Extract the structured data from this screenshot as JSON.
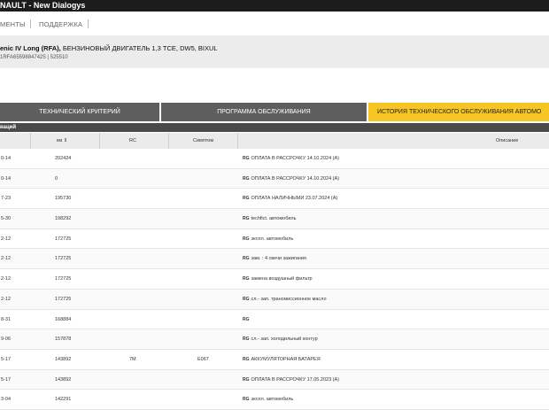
{
  "app": {
    "title": "NAULT -  New Dialogys"
  },
  "menu": {
    "items": [
      "МЕНТЫ",
      "ПОДДЕРЖКА"
    ]
  },
  "vehicle": {
    "name": "enic IV Long (RFA),",
    "engine": " БЕНЗИНОВЫЙ ДВИГАТЕЛЬ 1,3 TCE, DW5, BIXUL",
    "vin": "1RFA65598847425 | 525510"
  },
  "tabs": [
    {
      "label": "ТЕХНИЧЕСКИЙ КРИТЕРИЙ"
    },
    {
      "label": "ПРОГРАММА ОБСЛУЖИВАНИЯ"
    },
    {
      "label": "ИСТОРИЯ ТЕХНИЧЕСКОГО ОБСЛУЖИВАНИЯ АВТОМО"
    }
  ],
  "section": {
    "title": "ваций"
  },
  "table": {
    "headers": {
      "date": "",
      "km": "км ⇕",
      "rc": "RC",
      "symptom": "Симптом",
      "desc": "Описание"
    },
    "rows": [
      {
        "date": "0-14",
        "km": "202424",
        "rc": "",
        "sym": "",
        "badge": "RG",
        "desc": "ОПЛАТА В РАССРОЧКУ 14.10.2024 (A)"
      },
      {
        "date": "0-14",
        "km": "0",
        "rc": "",
        "sym": "",
        "badge": "RG",
        "desc": "ОПЛАТА В РАССРОЧКУ 14.10.2024 (A)"
      },
      {
        "date": "7-23",
        "km": "195730",
        "rc": "",
        "sym": "",
        "badge": "RG",
        "desc": "ОПЛАТА НАЛИЧНЫМИ 23.07.2024 (A)"
      },
      {
        "date": "5-30",
        "km": "198292",
        "rc": "",
        "sym": "",
        "badge": "RG",
        "desc": "techfict. автомобиль"
      },
      {
        "date": "2-12",
        "km": "172725",
        "rc": "",
        "sym": "",
        "badge": "RG",
        "desc": "экспл. автомобиль"
      },
      {
        "date": "2-12",
        "km": "172725",
        "rc": "",
        "sym": "",
        "badge": "RG",
        "desc": "зам. : 4 свечи зажигания"
      },
      {
        "date": "2-12",
        "km": "172725",
        "rc": "",
        "sym": "",
        "badge": "RG",
        "desc": "замена воздушный фильтр"
      },
      {
        "date": "2-12",
        "km": "172725",
        "rc": "",
        "sym": "",
        "badge": "RG",
        "desc": "сл.- зап. трансмиссионное масло"
      },
      {
        "date": "8-31",
        "km": "168884",
        "rc": "",
        "sym": "",
        "badge": "RG",
        "desc": ""
      },
      {
        "date": "9-06",
        "km": "157878",
        "rc": "",
        "sym": "",
        "badge": "RG",
        "desc": "сл.- зап. холодильный контур"
      },
      {
        "date": "5-17",
        "km": "143892",
        "rc": "7M",
        "sym": "E067",
        "badge": "RG",
        "desc": "АККУМУЛЯТОРНАЯ БАТАРЕЯ"
      },
      {
        "date": "5-17",
        "km": "143892",
        "rc": "",
        "sym": "",
        "badge": "RG",
        "desc": "ОПЛАТА В РАССРОЧКУ 17.05.2023 (A)"
      },
      {
        "date": "3-04",
        "km": "142291",
        "rc": "",
        "sym": "",
        "badge": "RG",
        "desc": "экспл. автомобиль"
      }
    ]
  }
}
